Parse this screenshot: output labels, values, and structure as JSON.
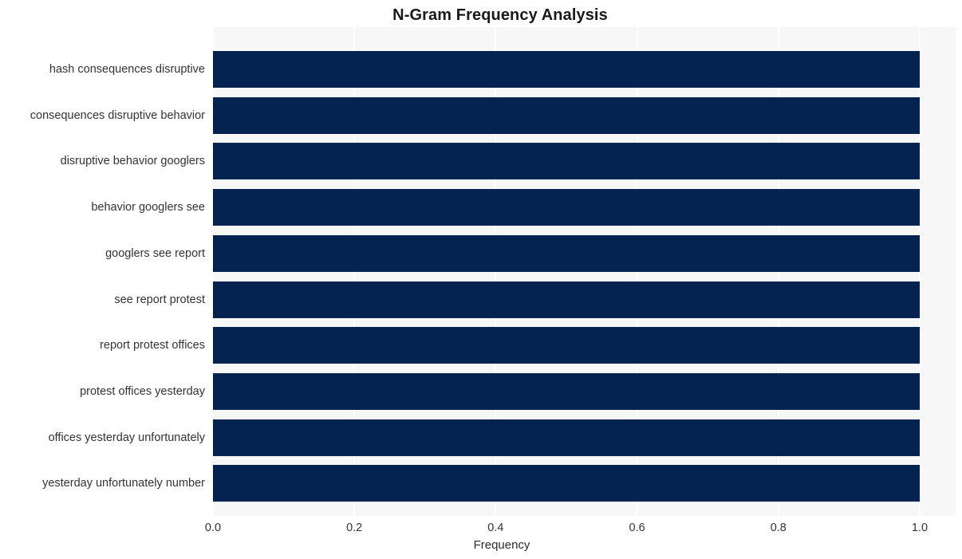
{
  "chart_data": {
    "type": "bar",
    "orientation": "horizontal",
    "title": "N-Gram Frequency Analysis",
    "xlabel": "Frequency",
    "ylabel": "",
    "xlim": [
      0.0,
      1.0
    ],
    "xticks": [
      "0.0",
      "0.2",
      "0.4",
      "0.6",
      "0.8",
      "1.0"
    ],
    "xtick_values": [
      0.0,
      0.2,
      0.4,
      0.6,
      0.8,
      1.0
    ],
    "grid": "vertical-white",
    "legend": "none",
    "bar_color": "#042350",
    "plot_background": "#f7f7f7",
    "figure_background": "#ffffff",
    "tick_label_color": "#333333",
    "title_color": "#1a1a1a",
    "categories": [
      "hash consequences disruptive",
      "consequences disruptive behavior",
      "disruptive behavior googlers",
      "behavior googlers see",
      "googlers see report",
      "see report protest",
      "report protest offices",
      "protest offices yesterday",
      "offices yesterday unfortunately",
      "yesterday unfortunately number"
    ],
    "values": [
      1.0,
      1.0,
      1.0,
      1.0,
      1.0,
      1.0,
      1.0,
      1.0,
      1.0,
      1.0
    ]
  }
}
